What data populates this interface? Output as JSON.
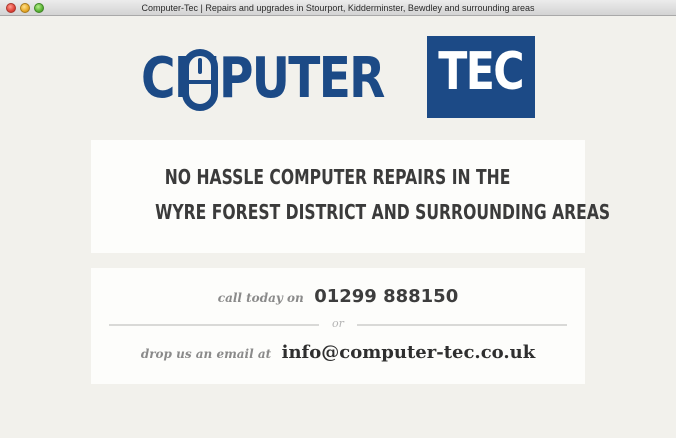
{
  "window": {
    "title": "Computer-Tec | Repairs and upgrades in Stourport, Kidderminster, Bewdley and surrounding areas"
  },
  "logo": {
    "text_blue_part1": "C",
    "text_blue_part2": "MPUTER",
    "text_box": "TEC",
    "brand_color": "#1c4a86"
  },
  "headline": {
    "line1": "NO HASSLE COMPUTER REPAIRS IN THE",
    "line2": "WYRE FOREST DISTRICT AND SURROUNDING AREAS"
  },
  "contact": {
    "phone_prompt": "call today on",
    "phone": "01299 888150",
    "separator": "or",
    "email_prompt": "drop us an email at",
    "email": "info@computer-tec.co.uk"
  },
  "icons": {
    "mouse": "mouse-icon"
  }
}
